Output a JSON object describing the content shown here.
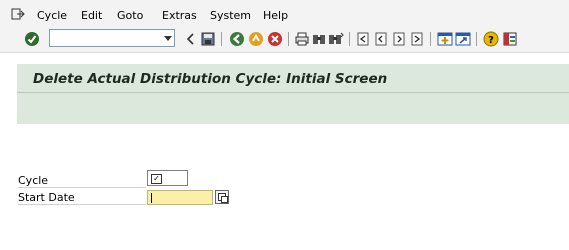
{
  "menu": {
    "items": [
      {
        "name": "menu-cycle",
        "label": "Cycle"
      },
      {
        "name": "menu-edit",
        "label": "Edit"
      },
      {
        "name": "menu-goto",
        "label": "Goto"
      },
      {
        "name": "menu-extras",
        "label": "Extras"
      },
      {
        "name": "menu-system",
        "label": "System"
      },
      {
        "name": "menu-help",
        "label": "Help"
      }
    ]
  },
  "toolbar": {
    "command_field_value": "",
    "icons": [
      "enter-check-icon",
      "command-dropdown-icon",
      "back-nav-icon",
      "save-icon",
      "back-icon",
      "exit-icon",
      "cancel-icon",
      "print-icon",
      "find-icon",
      "find-next-icon",
      "first-page-icon",
      "previous-page-icon",
      "next-page-icon",
      "last-page-icon",
      "create-session-icon",
      "shortcut-icon",
      "help-icon",
      "customize-layout-icon"
    ]
  },
  "screen": {
    "title": "Delete Actual Distribution Cycle: Initial Screen"
  },
  "form": {
    "cycle_label": "Cycle",
    "cycle_value": "",
    "start_date_label": "Start Date",
    "start_date_value": ""
  },
  "colors": {
    "title_band": "#dde8dd",
    "required_field": "#fbf0a8"
  }
}
